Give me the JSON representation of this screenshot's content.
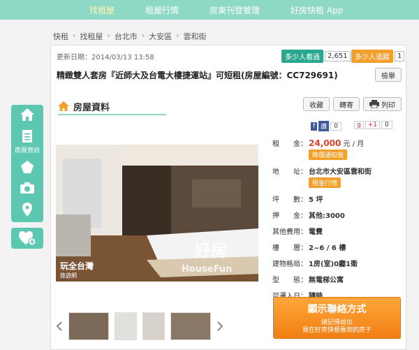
{
  "nav": {
    "items": [
      {
        "label": "找租屋",
        "active": true
      },
      {
        "label": "租屋行情",
        "active": false
      },
      {
        "label": "房東刊登管理",
        "active": false
      },
      {
        "label": "好房快租 App",
        "active": false
      }
    ]
  },
  "breadcrumb": [
    "快租",
    "找租屋",
    "台北市",
    "大安區",
    "雲和街"
  ],
  "listing": {
    "updated": "更新日期：2014/03/13 13:58",
    "views_label": "多少人看過",
    "views_count": "2,651",
    "follow_label": "多少人追蹤",
    "follow_count": "1",
    "title": "精緻雙人套房『近師大及台電大樓捷運站』可短租(房屋編號：CC729691)",
    "report_btn": "檢舉"
  },
  "section": {
    "title": "房屋資料",
    "collect_btn": "收藏",
    "send_btn": "轉寄",
    "print_btn": "列印"
  },
  "social": {
    "fb_label": "讚",
    "fb_count": "0",
    "gp_label": "+1",
    "gp_count": "0"
  },
  "details": {
    "rent_key": "租　　金：",
    "rent_value": "24,000",
    "rent_unit": "元 / 月",
    "price_alert_btn": "降價通知我",
    "addr_key": "地　　址：",
    "addr_value": "台北市大安區雲和街",
    "market_btn": "租金行情",
    "area_key": "坪　　數：",
    "area_value": "5 坪",
    "deposit_key": "押　　金：",
    "deposit_value": "其他:3000",
    "fee_key": "其他費用：",
    "fee_value": "電費",
    "floor_key": "樓　　層：",
    "floor_value": "2~6 / 6 樓",
    "layout_key": "建物格局：",
    "layout_value": "1房(室)0廳1衛",
    "type_key": "型　　態：",
    "type_value": "無電梯公寓",
    "move_key": "可遷入日：",
    "move_value": "隨時"
  },
  "contact": {
    "main": "顯示聯絡方式",
    "sub1": "請記得說出",
    "sub2": "我在好房快租看到的房子"
  },
  "photo": {
    "watermark": "好房",
    "watermark_sub": "HouseFun",
    "logo": "玩全台灣",
    "logo_sub": "旅遊網"
  },
  "sidebar": {
    "house_info_label": "房屋資訊"
  },
  "colors": {
    "nav_bg": "#8ed9c6",
    "accent_teal": "#5ec7b2",
    "price_red": "#e2402b",
    "orange": "#f29f2b"
  }
}
